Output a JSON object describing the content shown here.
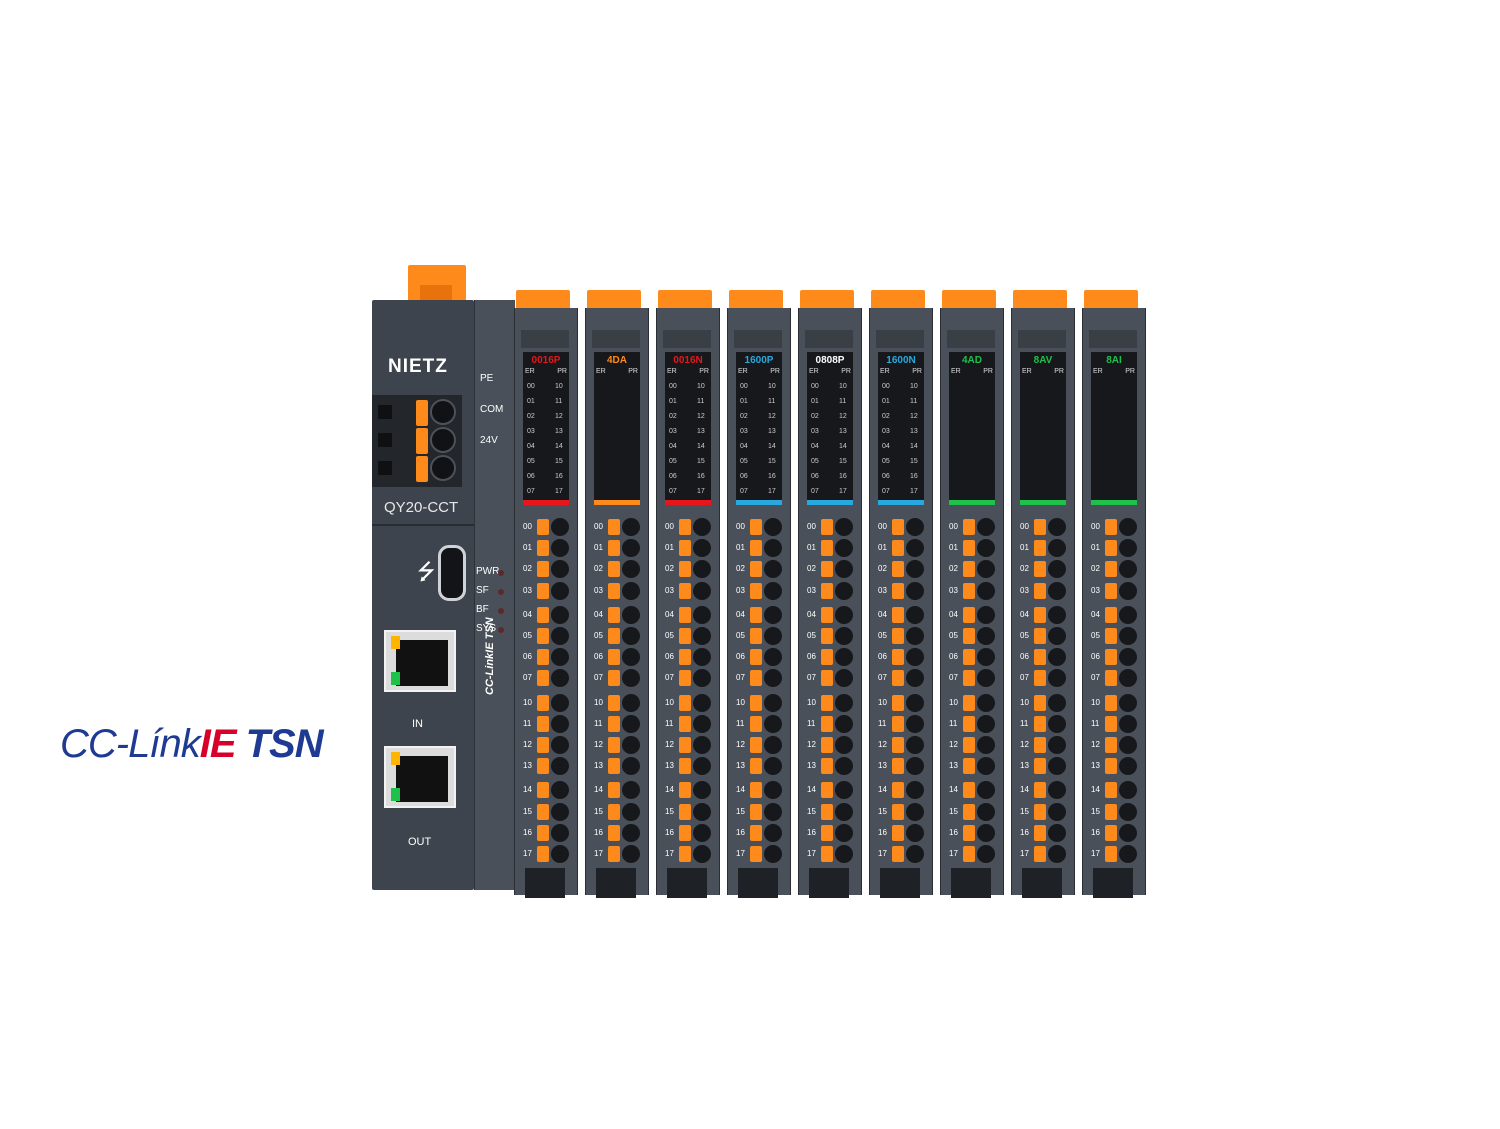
{
  "logo": {
    "cc": "CC-Línk",
    "ie": "IE",
    "tsn": "TSN"
  },
  "coupler": {
    "brand": "NIETZ",
    "model": "QY20-CCT",
    "terminal_labels": [
      "PE",
      "COM",
      "24V"
    ],
    "status_labels": [
      "PWR",
      "SF",
      "BF",
      "SYS"
    ],
    "port_in": "IN",
    "port_out": "OUT",
    "side_text": "CC-LinkIE TSN"
  },
  "module_er": "ER",
  "module_pr": "PR",
  "modules": [
    {
      "name": "0016P",
      "color": "#e8161b",
      "bar": "#e8161b"
    },
    {
      "name": "4DA",
      "color": "#ff8a1c",
      "bar": "#ff8a1c"
    },
    {
      "name": "0016N",
      "color": "#e8161b",
      "bar": "#e8161b"
    },
    {
      "name": "1600P",
      "color": "#29a8e0",
      "bar": "#29a8e0"
    },
    {
      "name": "0808P",
      "color": "#ffffff",
      "bar": "#29a8e0"
    },
    {
      "name": "1600N",
      "color": "#29a8e0",
      "bar": "#29a8e0"
    },
    {
      "name": "4AD",
      "color": "#1ec24a",
      "bar": "#1ec24a"
    },
    {
      "name": "8AV",
      "color": "#1ec24a",
      "bar": "#1ec24a"
    },
    {
      "name": "8AI",
      "color": "#1ec24a",
      "bar": "#1ec24a"
    }
  ],
  "window_channels_left": [
    "00",
    "01",
    "02",
    "03",
    "04",
    "05",
    "06",
    "07"
  ],
  "window_channels_right": [
    "10",
    "11",
    "12",
    "13",
    "14",
    "15",
    "16",
    "17"
  ],
  "io_labels": [
    "00",
    "01",
    "02",
    "03",
    "04",
    "05",
    "06",
    "07",
    "10",
    "11",
    "12",
    "13",
    "14",
    "15",
    "16",
    "17"
  ]
}
